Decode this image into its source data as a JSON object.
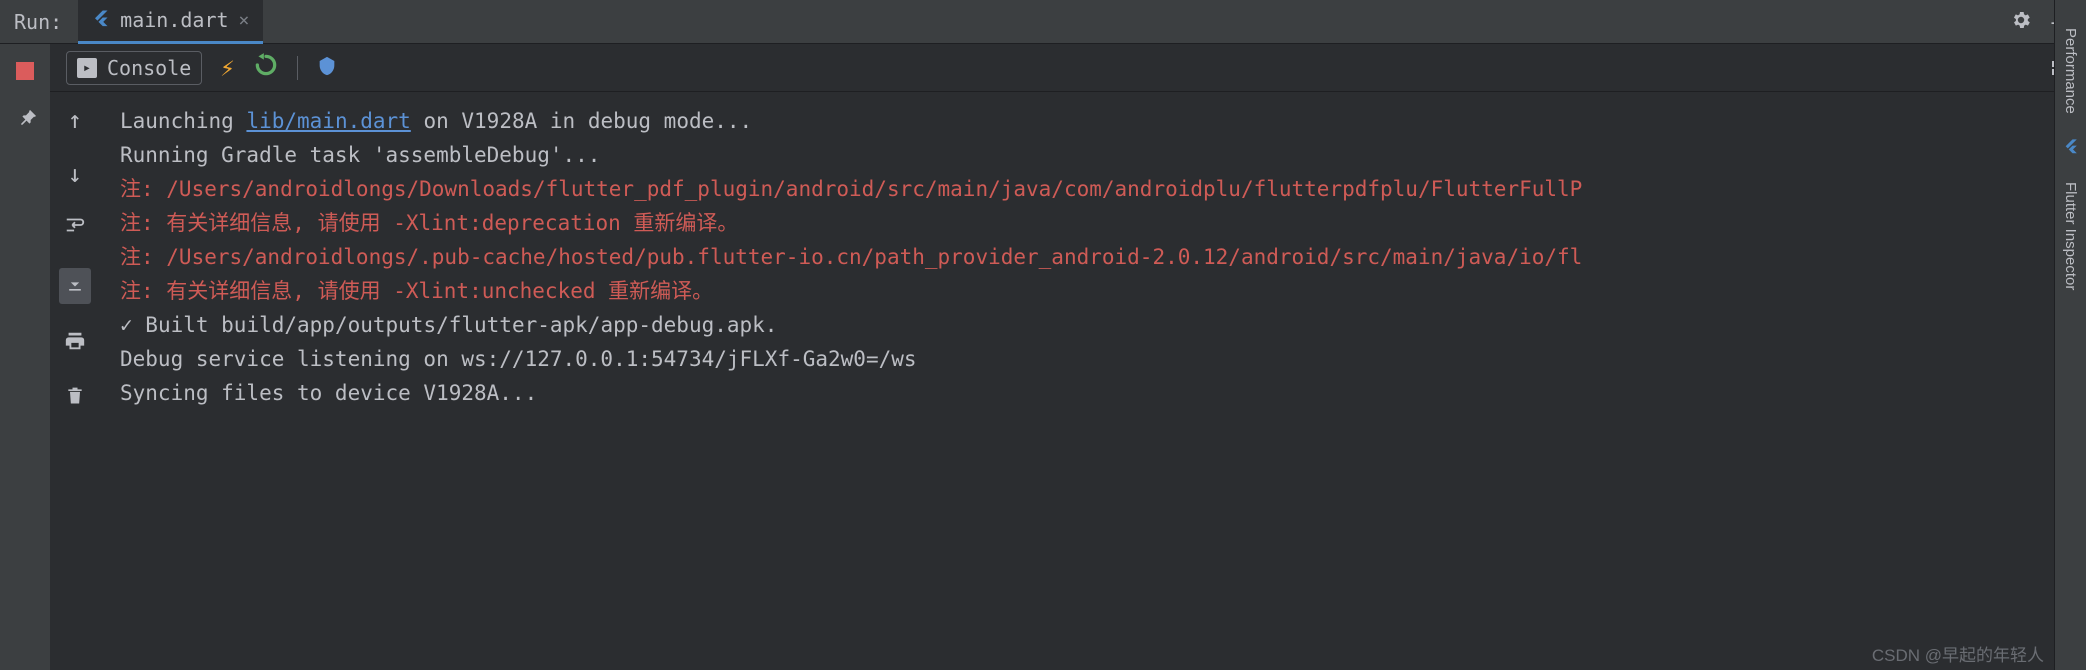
{
  "header": {
    "run_label": "Run:",
    "tab": {
      "icon": "flutter",
      "title": "main.dart"
    }
  },
  "toolbar": {
    "console_label": "Console"
  },
  "console": {
    "lines": [
      {
        "type": "launch",
        "prefix": "Launching ",
        "link": "lib/main.dart",
        "suffix": " on V1928A in debug mode..."
      },
      {
        "type": "normal",
        "text": "Running Gradle task 'assembleDebug'..."
      },
      {
        "type": "error",
        "text": "注: /Users/androidlongs/Downloads/flutter_pdf_plugin/android/src/main/java/com/androidplu/flutterpdfplu/FlutterFullP"
      },
      {
        "type": "error",
        "text": "注: 有关详细信息, 请使用 -Xlint:deprecation 重新编译。"
      },
      {
        "type": "error",
        "text": "注: /Users/androidlongs/.pub-cache/hosted/pub.flutter-io.cn/path_provider_android-2.0.12/android/src/main/java/io/fl"
      },
      {
        "type": "error",
        "text": "注: 有关详细信息, 请使用 -Xlint:unchecked 重新编译。"
      },
      {
        "type": "check",
        "prefix": "✓  ",
        "text": "Built build/app/outputs/flutter-apk/app-debug.apk."
      },
      {
        "type": "normal",
        "text": "Debug service listening on ws://127.0.0.1:54734/jFLXf-Ga2w0=/ws"
      },
      {
        "type": "normal",
        "text": "Syncing files to device V1928A..."
      }
    ]
  },
  "sidebar": {
    "tabs": [
      "Performance",
      "Flutter Inspector"
    ]
  },
  "watermark": "CSDN @早起的年轻人"
}
